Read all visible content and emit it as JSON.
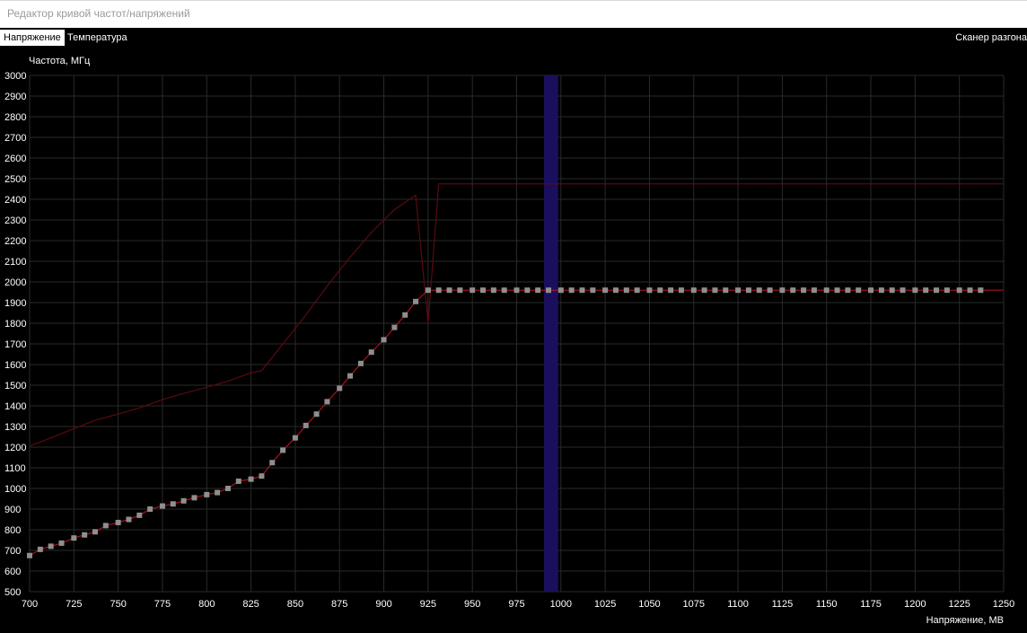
{
  "window": {
    "title": "Редактор кривой частот/напряжений"
  },
  "tabs": [
    {
      "label": "Напряжение",
      "active": true
    },
    {
      "label": "Температура",
      "active": false
    }
  ],
  "scanner_label": "Сканер разгона",
  "colors": {
    "background": "#000000",
    "grid": "#2a2a2a",
    "curve": "#b0101a",
    "max_curve": "#5a0a10",
    "point": "#8f8f8f",
    "selection": "#1a0f5c"
  },
  "chart_data": {
    "type": "line",
    "ylabel": "Частота, МГц",
    "xlabel": "Напряжение, МВ",
    "xlim": [
      700,
      1250
    ],
    "ylim": [
      500,
      3000
    ],
    "x_ticks": [
      700,
      725,
      750,
      775,
      800,
      825,
      850,
      875,
      900,
      925,
      950,
      975,
      1000,
      1025,
      1050,
      1075,
      1100,
      1125,
      1150,
      1175,
      1200,
      1225,
      1250
    ],
    "y_ticks": [
      500,
      600,
      700,
      800,
      900,
      1000,
      1100,
      1200,
      1300,
      1400,
      1500,
      1600,
      1700,
      1800,
      1900,
      2000,
      2100,
      2200,
      2300,
      2400,
      2500,
      2600,
      2700,
      2800,
      2900,
      3000
    ],
    "grid": true,
    "selected_voltage_band": [
      993,
      1000
    ],
    "curve_points": [
      [
        700,
        675
      ],
      [
        706,
        705
      ],
      [
        712,
        720
      ],
      [
        718,
        735
      ],
      [
        725,
        760
      ],
      [
        731,
        775
      ],
      [
        737,
        790
      ],
      [
        743,
        820
      ],
      [
        750,
        835
      ],
      [
        756,
        850
      ],
      [
        762,
        870
      ],
      [
        768,
        900
      ],
      [
        775,
        915
      ],
      [
        781,
        925
      ],
      [
        787,
        940
      ],
      [
        793,
        955
      ],
      [
        800,
        970
      ],
      [
        806,
        980
      ],
      [
        812,
        1000
      ],
      [
        818,
        1035
      ],
      [
        825,
        1045
      ],
      [
        831,
        1060
      ],
      [
        837,
        1125
      ],
      [
        843,
        1185
      ],
      [
        850,
        1245
      ],
      [
        856,
        1305
      ],
      [
        862,
        1360
      ],
      [
        868,
        1420
      ],
      [
        875,
        1485
      ],
      [
        881,
        1545
      ],
      [
        887,
        1605
      ],
      [
        893,
        1660
      ],
      [
        900,
        1720
      ],
      [
        906,
        1780
      ],
      [
        912,
        1840
      ],
      [
        918,
        1905
      ],
      [
        925,
        1960
      ],
      [
        931,
        1960
      ],
      [
        937,
        1960
      ],
      [
        943,
        1960
      ],
      [
        950,
        1960
      ],
      [
        956,
        1960
      ],
      [
        962,
        1960
      ],
      [
        968,
        1960
      ],
      [
        975,
        1960
      ],
      [
        981,
        1960
      ],
      [
        987,
        1960
      ],
      [
        993,
        1960
      ],
      [
        1000,
        1960
      ],
      [
        1006,
        1960
      ],
      [
        1012,
        1960
      ],
      [
        1018,
        1960
      ],
      [
        1025,
        1960
      ],
      [
        1031,
        1960
      ],
      [
        1037,
        1960
      ],
      [
        1043,
        1960
      ],
      [
        1050,
        1960
      ],
      [
        1056,
        1960
      ],
      [
        1062,
        1960
      ],
      [
        1068,
        1960
      ],
      [
        1075,
        1960
      ],
      [
        1081,
        1960
      ],
      [
        1087,
        1960
      ],
      [
        1093,
        1960
      ],
      [
        1100,
        1960
      ],
      [
        1106,
        1960
      ],
      [
        1112,
        1960
      ],
      [
        1118,
        1960
      ],
      [
        1125,
        1960
      ],
      [
        1131,
        1960
      ],
      [
        1137,
        1960
      ],
      [
        1143,
        1960
      ],
      [
        1150,
        1960
      ],
      [
        1156,
        1960
      ],
      [
        1162,
        1960
      ],
      [
        1168,
        1960
      ],
      [
        1175,
        1960
      ],
      [
        1181,
        1960
      ],
      [
        1187,
        1960
      ],
      [
        1193,
        1960
      ],
      [
        1200,
        1960
      ],
      [
        1206,
        1960
      ],
      [
        1212,
        1960
      ],
      [
        1218,
        1960
      ],
      [
        1225,
        1960
      ],
      [
        1231,
        1960
      ],
      [
        1237,
        1960
      ]
    ],
    "curve_tail": [
      [
        1250,
        1960
      ]
    ],
    "max_curve": [
      [
        700,
        1205
      ],
      [
        712,
        1245
      ],
      [
        725,
        1290
      ],
      [
        737,
        1330
      ],
      [
        750,
        1360
      ],
      [
        762,
        1390
      ],
      [
        775,
        1430
      ],
      [
        787,
        1460
      ],
      [
        800,
        1490
      ],
      [
        812,
        1520
      ],
      [
        825,
        1560
      ],
      [
        831,
        1570
      ],
      [
        843,
        1700
      ],
      [
        856,
        1840
      ],
      [
        868,
        1980
      ],
      [
        881,
        2120
      ],
      [
        893,
        2240
      ],
      [
        906,
        2350
      ],
      [
        918,
        2420
      ],
      [
        925,
        1800
      ],
      [
        931,
        2475
      ],
      [
        1250,
        2475
      ]
    ]
  }
}
